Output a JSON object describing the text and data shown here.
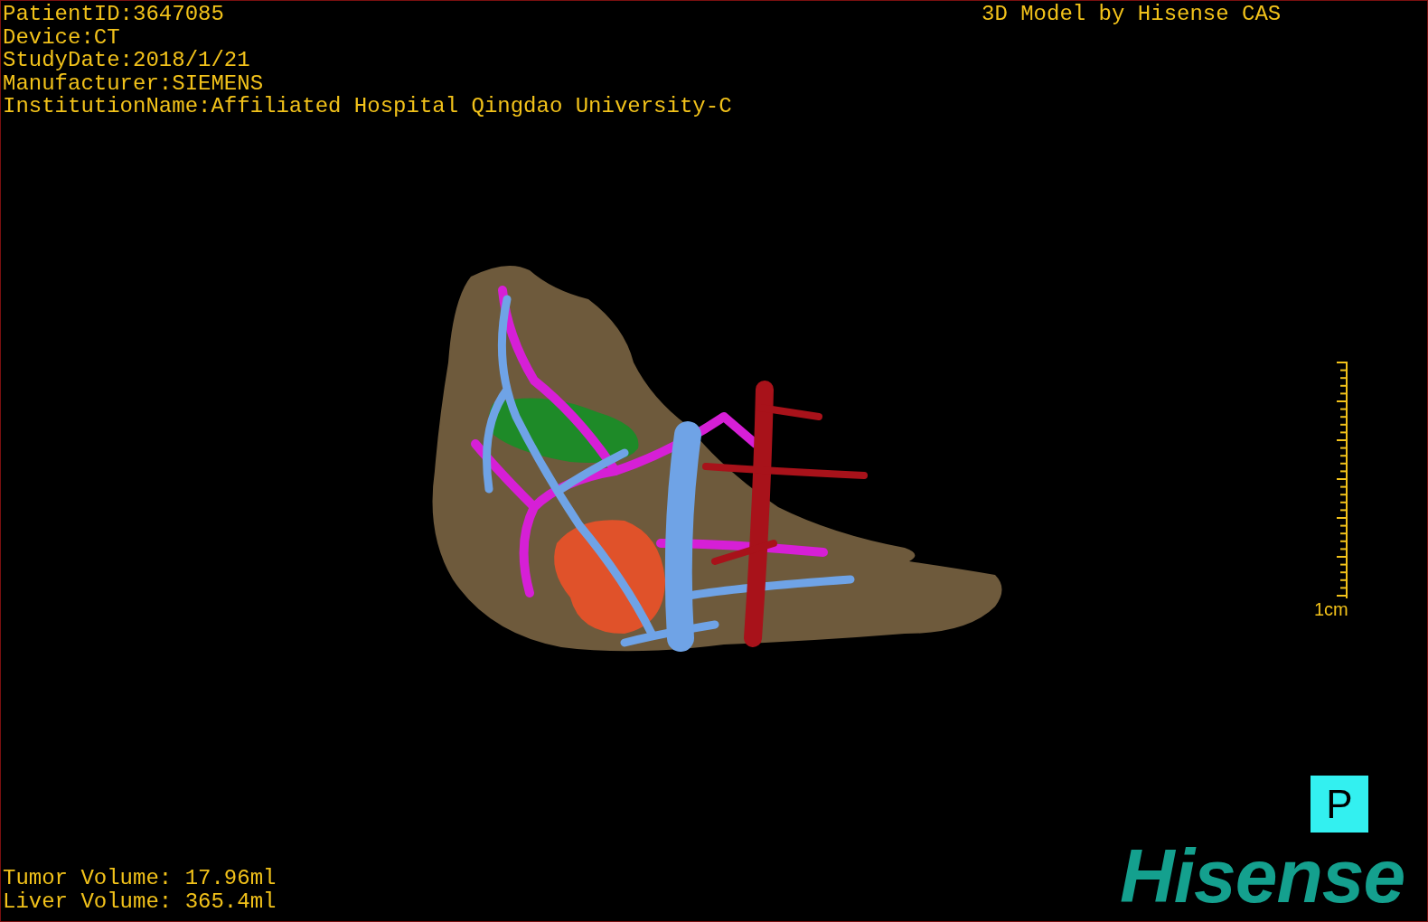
{
  "patient_info": [
    "PatientID:3647085",
    "Device:CT",
    "StudyDate:2018/1/21",
    "Manufacturer:SIEMENS",
    "InstitutionName:Affiliated Hospital Qingdao University-C"
  ],
  "title": "3D Model by Hisense CAS",
  "scale_bar": {
    "label": "1cm"
  },
  "orientation": "P",
  "volumes": [
    "Tumor Volume: 17.96ml",
    "Liver Volume: 365.4ml"
  ],
  "logo": "Hisense"
}
